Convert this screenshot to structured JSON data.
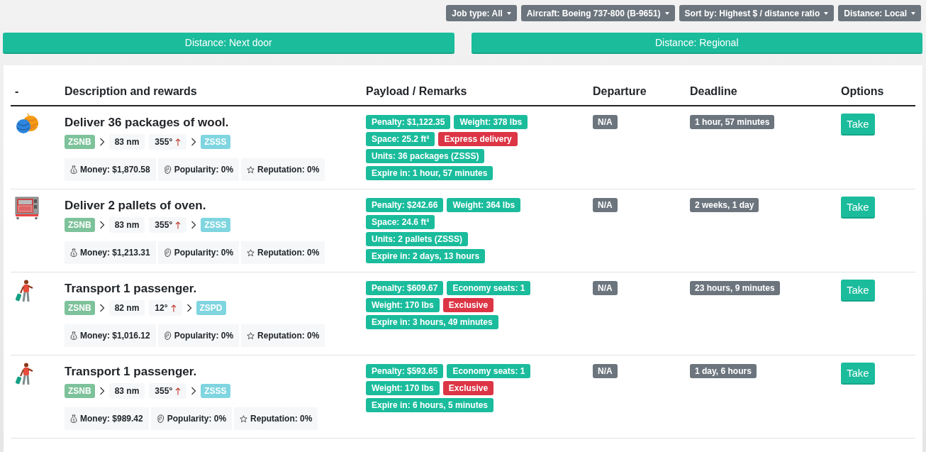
{
  "filters": [
    {
      "label": "Job type: All"
    },
    {
      "label": "Aircraft: Boeing 737-800 (B-9651)"
    },
    {
      "label": "Sort by: Highest $ / distance ratio"
    },
    {
      "label": "Distance: Local"
    }
  ],
  "distance_tabs": [
    {
      "label": "Distance: Next door"
    },
    {
      "label": "Distance: Regional"
    }
  ],
  "table": {
    "columns": [
      "-",
      "Description and rewards",
      "Payload / Remarks",
      "Departure",
      "Deadline",
      "Options"
    ],
    "rows": [
      {
        "kind": "wool",
        "title": "Deliver 36 packages of wool.",
        "origin": "ZSNB",
        "distance": "83 nm",
        "heading": "355°",
        "destination": "ZSSS",
        "money": "Money: $1,870.58",
        "popularity": "Popularity: 0%",
        "reputation": "Reputation: 0%",
        "tags": [
          {
            "text": "Penalty: $1,122.35",
            "kind": "info"
          },
          {
            "text": "Weight: 378 lbs",
            "kind": "info"
          },
          {
            "text": "Space: 25.2 ft³",
            "kind": "info"
          },
          {
            "text": "Express delivery",
            "kind": "alert"
          },
          {
            "text": "Units: 36 packages (ZSSS)",
            "kind": "info"
          },
          {
            "text": "Expire in: 1 hour, 57 minutes",
            "kind": "info"
          }
        ],
        "departure": "N/A",
        "deadline": "1 hour, 57 minutes",
        "action": "Take"
      },
      {
        "kind": "oven",
        "title": "Deliver 2 pallets of oven.",
        "origin": "ZSNB",
        "distance": "83 nm",
        "heading": "355°",
        "destination": "ZSSS",
        "money": "Money: $1,213.31",
        "popularity": "Popularity: 0%",
        "reputation": "Reputation: 0%",
        "tags": [
          {
            "text": "Penalty: $242.66",
            "kind": "info"
          },
          {
            "text": "Weight: 364 lbs",
            "kind": "info"
          },
          {
            "text": "Space: 24.6 ft³",
            "kind": "info"
          },
          {
            "text": "Units: 2 pallets (ZSSS)",
            "kind": "info"
          },
          {
            "text": "Expire in: 2 days, 13 hours",
            "kind": "info"
          }
        ],
        "departure": "N/A",
        "deadline": "2 weeks, 1 day",
        "action": "Take"
      },
      {
        "kind": "passenger",
        "title": "Transport 1 passenger.",
        "origin": "ZSNB",
        "distance": "82 nm",
        "heading": "12°",
        "destination": "ZSPD",
        "money": "Money: $1,016.12",
        "popularity": "Popularity: 0%",
        "reputation": "Reputation: 0%",
        "tags": [
          {
            "text": "Penalty: $609.67",
            "kind": "info"
          },
          {
            "text": "Economy seats: 1",
            "kind": "info"
          },
          {
            "text": "Weight: 170 lbs",
            "kind": "info"
          },
          {
            "text": "Exclusive",
            "kind": "alert"
          },
          {
            "text": "Expire in: 3 hours, 49 minutes",
            "kind": "info"
          }
        ],
        "departure": "N/A",
        "deadline": "23 hours, 9 minutes",
        "action": "Take"
      },
      {
        "kind": "passenger",
        "title": "Transport 1 passenger.",
        "origin": "ZSNB",
        "distance": "83 nm",
        "heading": "355°",
        "destination": "ZSSS",
        "money": "Money: $989.42",
        "popularity": "Popularity: 0%",
        "reputation": "Reputation: 0%",
        "tags": [
          {
            "text": "Penalty: $593.65",
            "kind": "info"
          },
          {
            "text": "Economy seats: 1",
            "kind": "info"
          },
          {
            "text": "Weight: 170 lbs",
            "kind": "info"
          },
          {
            "text": "Exclusive",
            "kind": "alert"
          },
          {
            "text": "Expire in: 6 hours, 5 minutes",
            "kind": "info"
          }
        ],
        "departure": "N/A",
        "deadline": "1 day, 6 hours",
        "action": "Take"
      }
    ]
  }
}
